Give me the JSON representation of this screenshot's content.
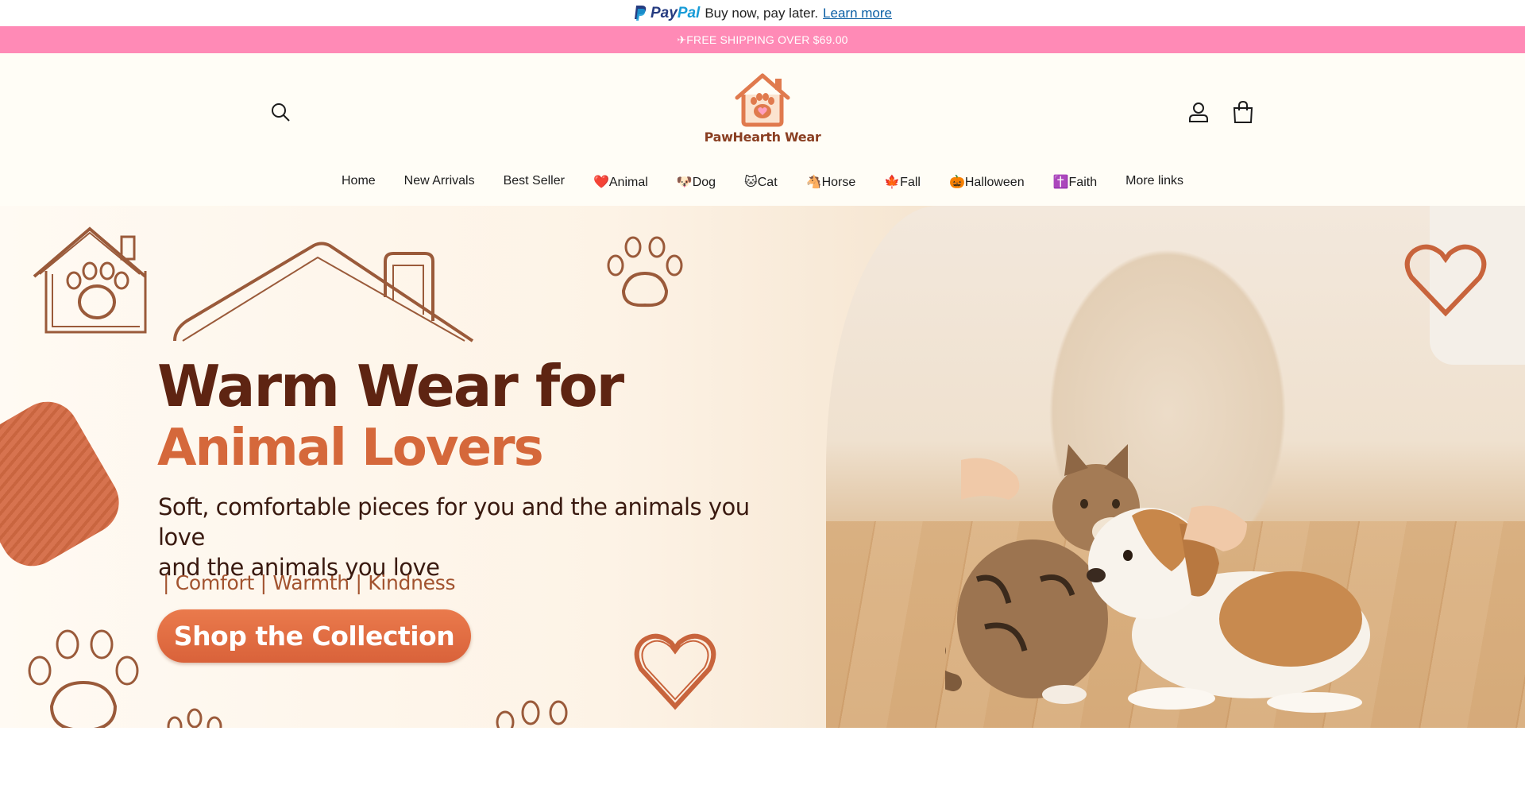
{
  "paypal": {
    "logo_text_1": "Pay",
    "logo_text_2": "Pal",
    "message": "Buy now, pay later.",
    "link": "Learn more"
  },
  "shipping_bar": {
    "text": "✈FREE SHIPPING OVER $69.00"
  },
  "header": {
    "logo_name": "PawHearth Wear",
    "icons": [
      "search-icon",
      "account-icon",
      "cart-icon"
    ]
  },
  "nav": {
    "items": [
      {
        "label": "Home"
      },
      {
        "label": "New Arrivals"
      },
      {
        "label": "Best Seller"
      },
      {
        "label": "❤️Animal"
      },
      {
        "label": "🐶Dog"
      },
      {
        "label": "🐱Cat"
      },
      {
        "label": "🐴Horse"
      },
      {
        "label": "🍁Fall"
      },
      {
        "label": "🎃Halloween"
      },
      {
        "label": "✝️Faith"
      },
      {
        "label": "More links"
      }
    ]
  },
  "hero": {
    "title_line1": "Warm Wear for",
    "title_line2": "Animal Lovers",
    "subtitle_line1": "Soft, comfortable pieces for you and the animals you love",
    "subtitle_line2": "and the animals you love",
    "values": "| Comfort | Warmth | Kindness",
    "cta_label": "Shop the Collection"
  },
  "colors": {
    "shipping_bar": "#ff8ab6",
    "title_dark": "#5e2412",
    "title_accent": "#d5683b",
    "cta": "#e06c42",
    "header_bg": "#fffdf6"
  }
}
